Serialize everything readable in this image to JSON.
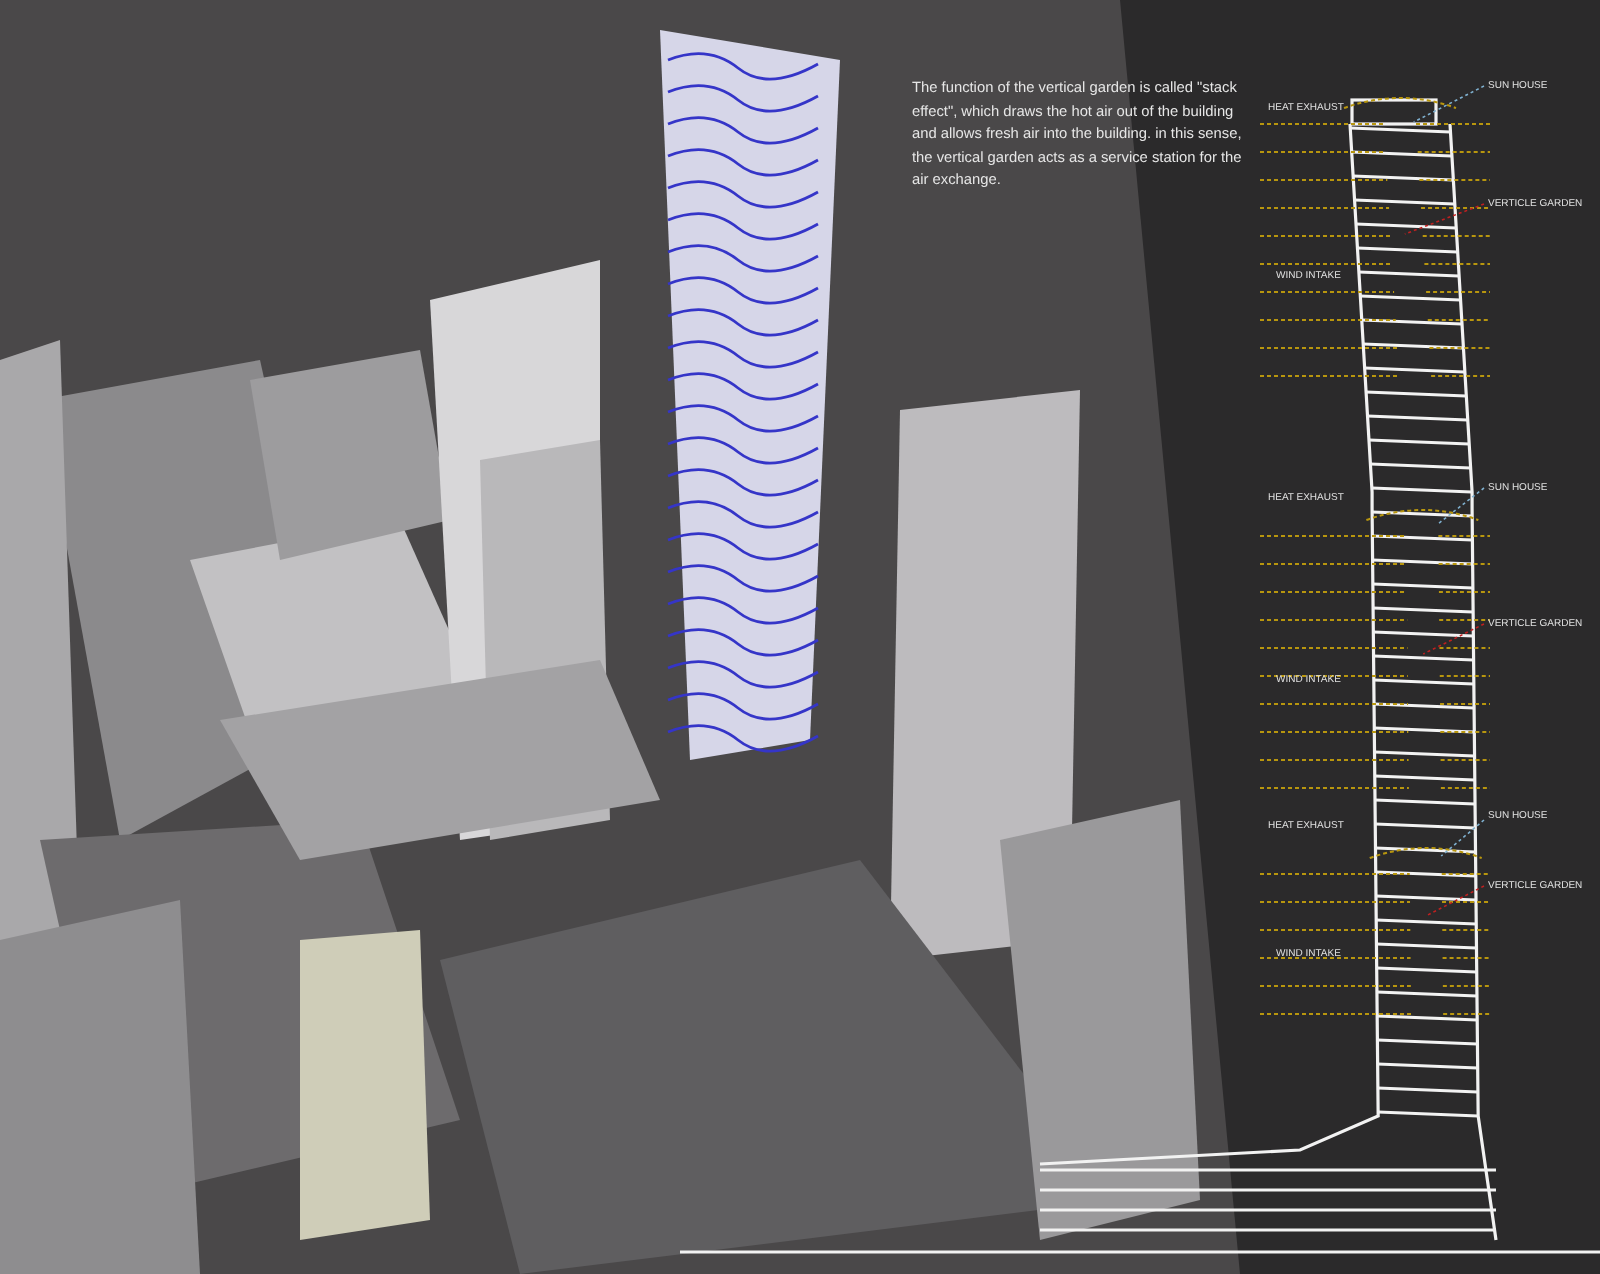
{
  "description": {
    "text": "The function of the vertical garden is called \"stack effect\", which draws the hot air out of the building and allows fresh air into the building. in this sense, the vertical garden acts as a service station for the air exchange."
  },
  "diagram": {
    "sections": [
      {
        "heat_exhaust": "HEAT EXHAUST",
        "sun_house": "SUN HOUSE",
        "vertical_garden": "VERTICLE GARDEN",
        "wind_intake": "WIND INTAKE"
      },
      {
        "heat_exhaust": "HEAT EXHAUST",
        "sun_house": "SUN HOUSE",
        "vertical_garden": "VERTICLE GARDEN",
        "wind_intake": "WIND INTAKE"
      },
      {
        "heat_exhaust": "HEAT EXHAUST",
        "sun_house": "SUN HOUSE",
        "vertical_garden": "VERTICLE GARDEN",
        "wind_intake": "WIND INTAKE"
      }
    ]
  }
}
